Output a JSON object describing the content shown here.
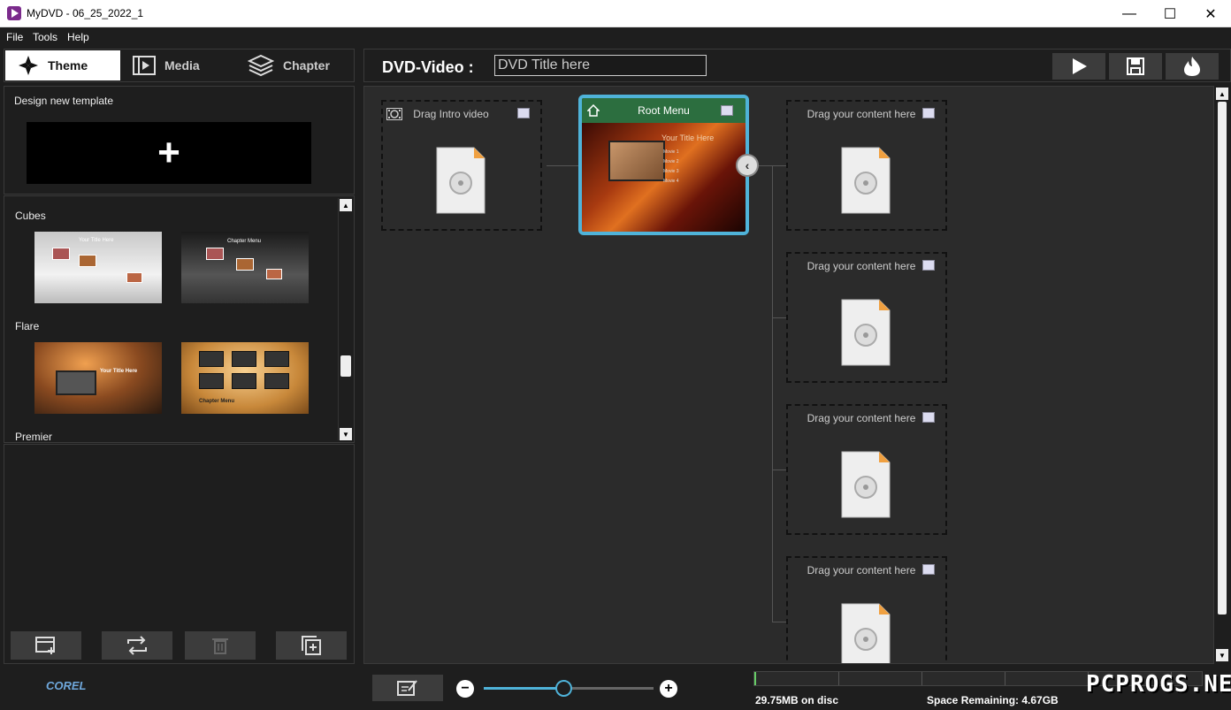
{
  "window": {
    "title": "MyDVD - 06_25_2022_1"
  },
  "menu": [
    "File",
    "Tools",
    "Help"
  ],
  "left_tabs": [
    {
      "label": "Theme",
      "icon": "theme-icon",
      "active": true
    },
    {
      "label": "Media",
      "icon": "media-icon",
      "active": false
    },
    {
      "label": "Chapter",
      "icon": "layers-icon",
      "active": false
    }
  ],
  "design": {
    "label": "Design new template",
    "plus": "+"
  },
  "themes": {
    "categories": [
      "Cubes",
      "Flare",
      "Premier"
    ],
    "thumb_texts": {
      "cubes_1": "Your Title Here",
      "cubes_2": "Chapter Menu",
      "flare_1": "Your Title Here",
      "flare_2": "Chapter Menu"
    }
  },
  "bottom_buttons": [
    "add-template-icon",
    "swap-icon",
    "delete-icon",
    "duplicate-icon"
  ],
  "header": {
    "label": "DVD-Video :",
    "title_placeholder": "DVD Title here",
    "buttons": [
      "play-icon",
      "save-icon",
      "burn-icon"
    ]
  },
  "canvas": {
    "intro_label": "Drag Intro video",
    "root_menu_label": "Root Menu",
    "root_menu_title": "Your Title Here",
    "root_menu_items": [
      "Movie 1",
      "Movie 2",
      "Movie 3",
      "Movie 4"
    ],
    "content_slots": [
      "Drag your content here",
      "Drag your content here",
      "Drag your content here",
      "Drag your content here"
    ]
  },
  "status": {
    "disc_used": "29.75MB on disc",
    "space_remaining": "Space Remaining: 4.67GB",
    "zoom_level": 0.47
  },
  "branding": {
    "logo": "COREL",
    "watermark": "PCPROGS.NET"
  },
  "colors": {
    "accent": "#4fb3d9",
    "root_header": "#2c6e3f"
  }
}
